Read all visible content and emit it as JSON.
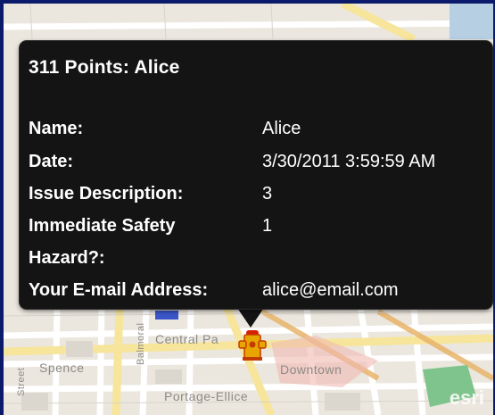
{
  "popup": {
    "title": "311 Points: Alice",
    "fields": [
      {
        "key": "Name:",
        "value": "Alice"
      },
      {
        "key": "Date:",
        "value": "3/30/2011 3:59:59 AM"
      },
      {
        "key": "Issue Description:",
        "value": "3"
      },
      {
        "key": "Immediate Safety",
        "value": "1"
      },
      {
        "key": "Hazard?:",
        "value": ""
      },
      {
        "key": "Your E-mail Address:",
        "value": "alice@email.com"
      }
    ]
  },
  "map": {
    "labels": {
      "spence": "Spence",
      "central": "Central Pa",
      "downtown": "Downtown",
      "portage": "Portage-Ellice",
      "balmoral": "Balmoral",
      "street": "Street"
    },
    "attribution": "esri",
    "marker_icon": "fire-hydrant-icon"
  },
  "colors": {
    "popup_bg": "#141414",
    "frame": "#1b2a86",
    "marker": "#e8a400"
  }
}
